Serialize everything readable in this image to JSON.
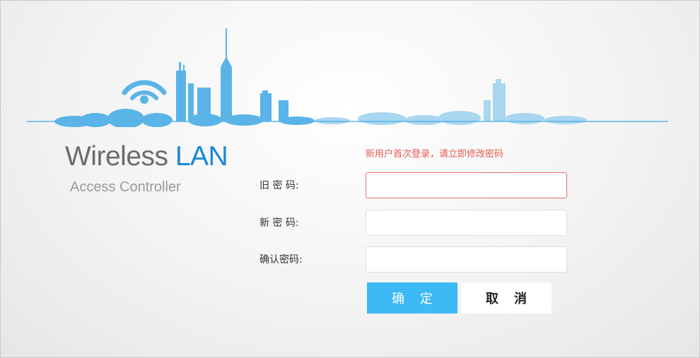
{
  "brand": {
    "title_main": "Wireless",
    "title_accent": "LAN",
    "subtitle": "Access Controller",
    "accent_color": "#1a88d6"
  },
  "form": {
    "notice": "新用户首次登录，请立即修改密码",
    "old_password_label": "旧 密 码:",
    "new_password_label": "新 密 码:",
    "confirm_password_label": "确认密码:",
    "old_password_value": "",
    "new_password_value": "",
    "confirm_password_value": ""
  },
  "buttons": {
    "confirm_label": "确 定",
    "cancel_label": "取 消"
  },
  "colors": {
    "skyline_blue": "#5ab4e8",
    "skyline_light": "#a9d6f0",
    "notice_red": "#e85a4f",
    "confirm_button": "#3db9f5"
  },
  "icons": [
    "wifi-icon",
    "city-skyline"
  ]
}
